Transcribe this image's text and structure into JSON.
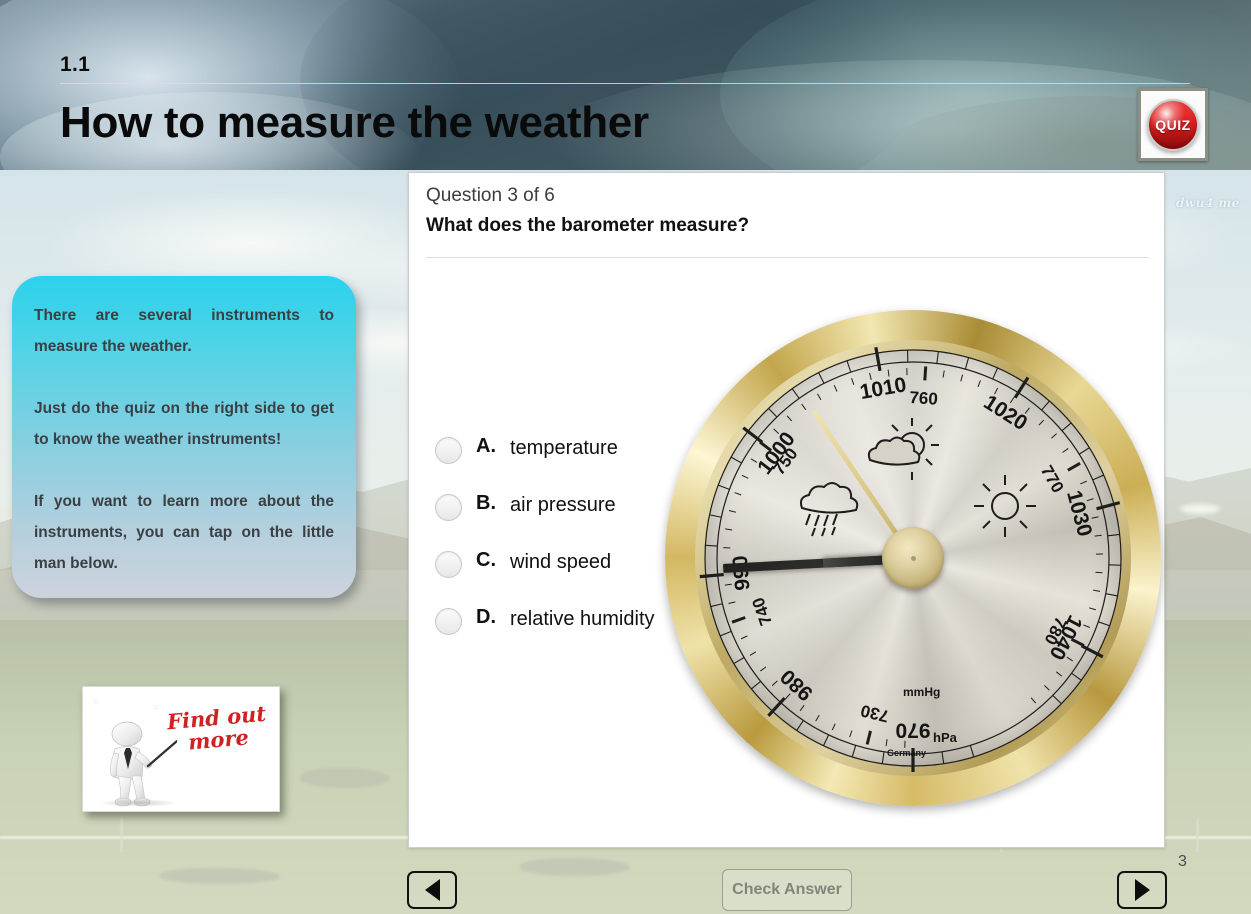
{
  "header": {
    "section_number": "1.1",
    "title": "How to measure the weather",
    "quiz_badge_label": "QUIZ"
  },
  "info_box": {
    "paragraphs": [
      "There are several instruments to measure the weather.",
      "Just do the quiz on the right side to get to know the weather instruments!",
      "If you want to learn more about the instruments, you can tap on the little man below."
    ],
    "background_color_top": "#2cd2ec",
    "background_color_bottom": "#ccd3de",
    "text_color": "#3a3f44"
  },
  "find_out_more": {
    "line1": "Find out",
    "line2": "more",
    "text_color": "#cf2222"
  },
  "quiz": {
    "question_counter": "Question 3 of 6",
    "question_text": "What does the barometer measure?",
    "options": [
      {
        "letter": "A.",
        "label": "temperature",
        "selected": false
      },
      {
        "letter": "B.",
        "label": "air pressure",
        "selected": false
      },
      {
        "letter": "C.",
        "label": "wind speed",
        "selected": false
      },
      {
        "letter": "D.",
        "label": "relative humidity",
        "selected": false
      }
    ]
  },
  "barometer": {
    "hpa_labels": [
      "970",
      "980",
      "990",
      "1000",
      "1010",
      "1020",
      "1030",
      "1040"
    ],
    "mmhg_labels": [
      "730",
      "740",
      "750",
      "760",
      "770",
      "780"
    ],
    "unit_outer": "hPa",
    "unit_inner": "mmHg",
    "origin": "Germany",
    "weather_icons": [
      "rain-cloud-icon",
      "sun-behind-cloud-icon",
      "sun-icon"
    ],
    "pointer_reading_hpa": "990",
    "bezel_color": "#d3b862",
    "dial_color": "#d6d2c8"
  },
  "footer": {
    "prev_label": "prev-arrow",
    "next_label": "next-arrow",
    "check_answer_label": "Check Answer",
    "page_number": "3"
  },
  "watermark": {
    "text": "dwu4 me"
  }
}
